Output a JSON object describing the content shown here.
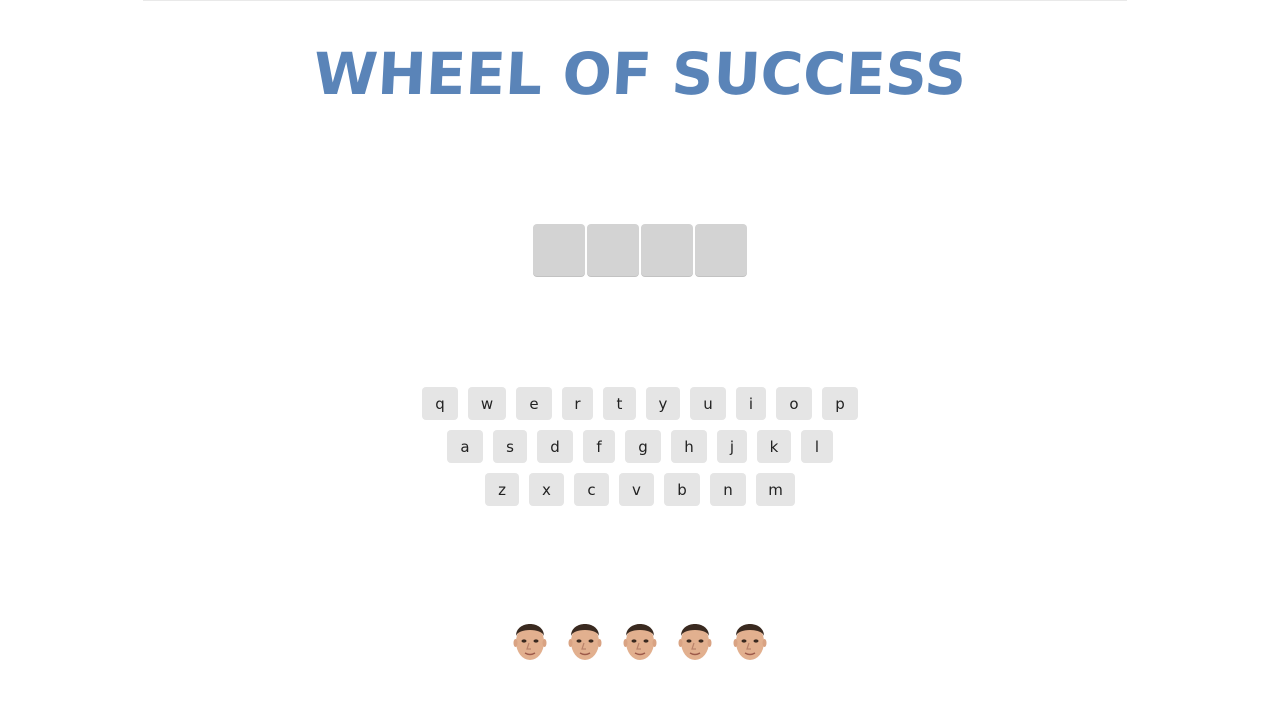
{
  "header": {
    "title": "WHEEL OF SUCCESS"
  },
  "phrase": {
    "letter_count": 4,
    "tiles": [
      "",
      "",
      "",
      ""
    ]
  },
  "keyboard": {
    "rows": [
      [
        "q",
        "w",
        "e",
        "r",
        "t",
        "y",
        "u",
        "i",
        "o",
        "p"
      ],
      [
        "a",
        "s",
        "d",
        "f",
        "g",
        "h",
        "j",
        "k",
        "l"
      ],
      [
        "z",
        "x",
        "c",
        "v",
        "b",
        "n",
        "m"
      ]
    ]
  },
  "lives": {
    "remaining": 5,
    "icon": "face-icon"
  },
  "colors": {
    "title": "#5a84b8",
    "tile": "#d3d3d3",
    "key": "#e5e5e5"
  }
}
